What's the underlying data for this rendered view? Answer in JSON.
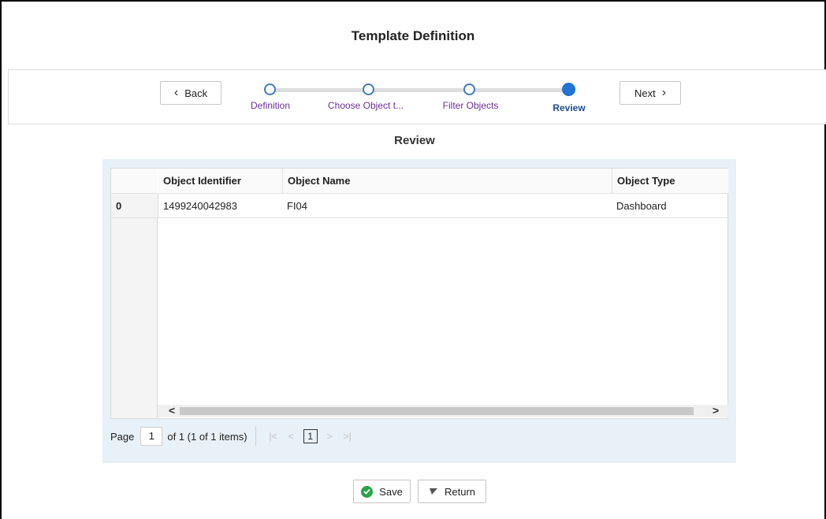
{
  "page": {
    "title": "Template Definition"
  },
  "train": {
    "back_label": "Back",
    "next_label": "Next",
    "steps": [
      {
        "label": "Definition"
      },
      {
        "label": "Choose Object t..."
      },
      {
        "label": "Filter Objects"
      },
      {
        "label": "Review"
      }
    ],
    "current_step": "Review"
  },
  "review": {
    "title": "Review",
    "columns": [
      "Object Identifier",
      "Object Name",
      "Object Type"
    ],
    "rows": [
      {
        "index": "0",
        "object_identifier": "1499240042983",
        "object_name": "FI04",
        "object_type": "Dashboard"
      }
    ],
    "pager": {
      "page_label": "Page",
      "page_value": "1",
      "of_text": "of 1 (1 of 1 items)",
      "current_page": "1"
    }
  },
  "footer": {
    "save_label": "Save",
    "return_label": "Return"
  },
  "colors": {
    "step_current": "#1f74d6",
    "step_link": "#6a2f97",
    "save_icon": "#2aa34a",
    "panel_bg": "#e8f0f8"
  }
}
